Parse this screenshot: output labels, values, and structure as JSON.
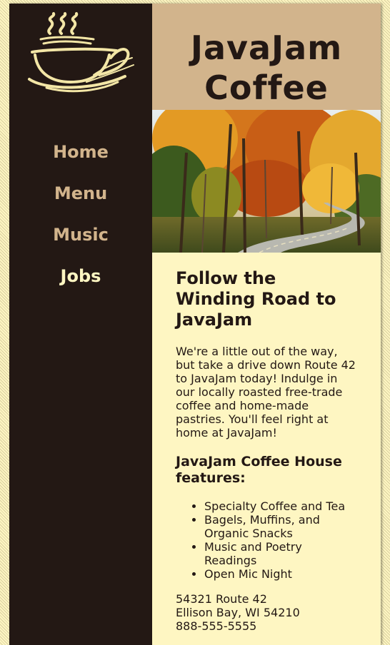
{
  "header": {
    "title_line1": "JavaJam",
    "title_line2": "Coffee"
  },
  "logo": {
    "icon": "steaming-coffee-cup-icon"
  },
  "nav": {
    "items": [
      {
        "label": "Home",
        "current": false
      },
      {
        "label": "Menu",
        "current": false
      },
      {
        "label": "Music",
        "current": false
      },
      {
        "label": "Jobs",
        "current": true
      }
    ]
  },
  "hero": {
    "subject": "winding road through autumn forest"
  },
  "main": {
    "heading": "Follow the Winding Road to JavaJam",
    "intro": "We're a little out of the way, but take a drive down Route 42 to JavaJam today! Indulge in our locally roasted free-trade coffee and home-made pastries. You'll feel right at home at JavaJam!",
    "features_heading": "JavaJam Coffee House features:",
    "features": [
      "Specialty Coffee and Tea",
      "Bagels, Muffins, and Organic Snacks",
      "Music and Poetry Readings",
      "Open Mic Night"
    ],
    "contact": {
      "address": "54321 Route 42",
      "city": "Ellison Bay, WI 54210",
      "phone": "888-555-5555"
    }
  },
  "colors": {
    "dark_brown": "#231814",
    "tan": "#d2b48c",
    "cream": "#fef6c2"
  }
}
